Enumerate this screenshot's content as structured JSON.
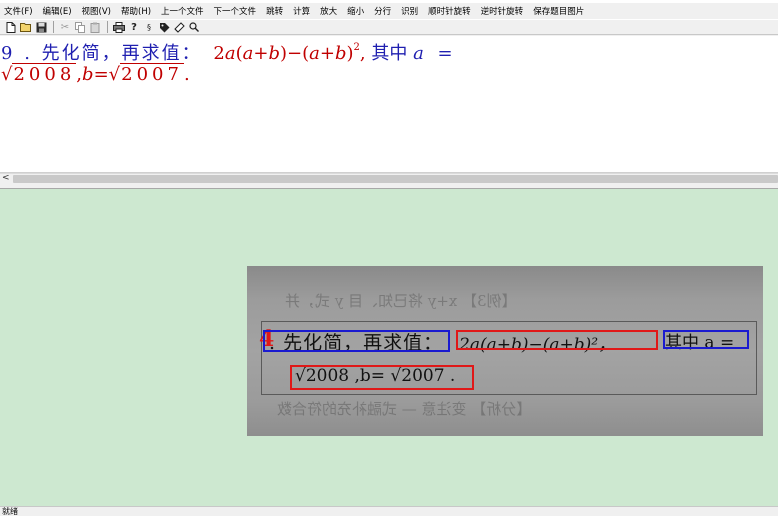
{
  "menu": {
    "items": [
      "文件(F)",
      "编辑(E)",
      "视图(V)",
      "帮助(H)",
      "上一个文件",
      "下一个文件",
      "跳转",
      "计算",
      "放大",
      "缩小",
      "分行",
      "识别",
      "顺时针旋转",
      "逆时针旋转",
      "保存题目图片"
    ]
  },
  "toolbar": {
    "icons": [
      "new-file-icon",
      "open-folder-icon",
      "save-icon",
      "cut-icon",
      "copy-icon",
      "paste-icon",
      "print-icon",
      "help-icon",
      "recognize-icon",
      "tag-icon",
      "eraser-icon",
      "search-icon"
    ]
  },
  "editor": {
    "q_num": "9",
    "q_dot": ".",
    "q_text": "先化简，再求值：",
    "expr_a": "2",
    "var_a": "a",
    "expr_open": "(",
    "expr_mid1": "a",
    "expr_plus": "+",
    "var_b": "b",
    "expr_close_minus": ")−(",
    "expr_a2": "a",
    "expr_plus2": "+",
    "expr_b2": "b",
    "expr_close2": ")",
    "expr_exp": "2",
    "comma1": ",",
    "q_tail": "其中",
    "q_var": "a",
    "q_eq": "=",
    "line2_rad1": "2008",
    "line2_comma": ",",
    "line2_b": "b",
    "line2_eq": "=",
    "line2_rad2": "2007",
    "line2_period": "."
  },
  "scrollbar": {
    "arrow": "<"
  },
  "image": {
    "question_number": "4",
    "text_label": ". 先化简，再求值：",
    "formula": "2a(a+b)−(a+b)²，",
    "tail": "其中 a =",
    "line2": "√2008 ,b= √2007 .",
    "ghost_top": "【例3】 x+y 将已知、目 y 式，并",
    "ghost_bottom": "【分析】 变注意 — 式融补充的符合数",
    "box_colors": {
      "text": "#1a1ad0",
      "formula": "#e01818"
    }
  },
  "status": {
    "text": "就绪"
  }
}
